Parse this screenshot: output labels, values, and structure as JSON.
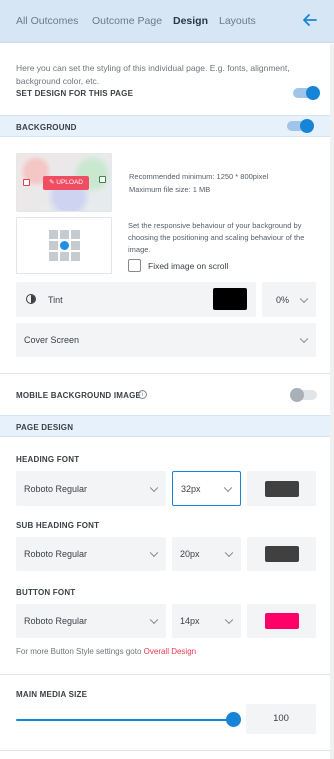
{
  "tabs": [
    {
      "label": "All Outcomes",
      "active": false
    },
    {
      "label": "Outcome Page",
      "active": false
    },
    {
      "label": "Design",
      "active": true
    },
    {
      "label": "Layouts",
      "active": false
    }
  ],
  "header": {
    "back_icon": "arrow-left-icon"
  },
  "intro": {
    "text": "Here you can set the styling of this individual page. E.g. fonts, alignment, background color, etc.",
    "set_design_label": "SET DESIGN FOR THIS PAGE",
    "set_design_on": true
  },
  "background": {
    "title": "BACKGROUND",
    "enabled": true,
    "upload_label": "UPLOAD",
    "recommended": "Recommended minimum: 1250 * 800pixel",
    "max_size": "Maximum file size: 1 MB",
    "responsive_text": "Set the responsive behaviour of your background by choosing the positioning and scaling behaviour of the image.",
    "fixed_label": "Fixed image on scroll",
    "fixed_checked": false,
    "tint_label": "Tint",
    "tint_color": "#000000",
    "tint_percent": "0%",
    "scaling": "Cover Screen"
  },
  "mobile_bg": {
    "label": "MOBILE BACKGROUND IMAGE",
    "info": "i",
    "enabled": false
  },
  "page_design": {
    "title": "PAGE DESIGN",
    "heading_font": {
      "label": "HEADING FONT",
      "font": "Roboto Regular",
      "size": "32px",
      "color": "#404040"
    },
    "sub_heading_font": {
      "label": "SUB HEADING FONT",
      "font": "Roboto Regular",
      "size": "20px",
      "color": "#404040"
    },
    "button_font": {
      "label": "BUTTON FONT",
      "font": "Roboto Regular",
      "size": "14px",
      "color": "#ff0066"
    },
    "note_text": "For more Button Style settings goto",
    "note_link": "Overall Design"
  },
  "media": {
    "label": "MAIN MEDIA SIZE",
    "value": "100"
  },
  "colors": {
    "accent": "#1685d8",
    "header_bg": "#d7e6f5",
    "link": "#e8394f"
  }
}
